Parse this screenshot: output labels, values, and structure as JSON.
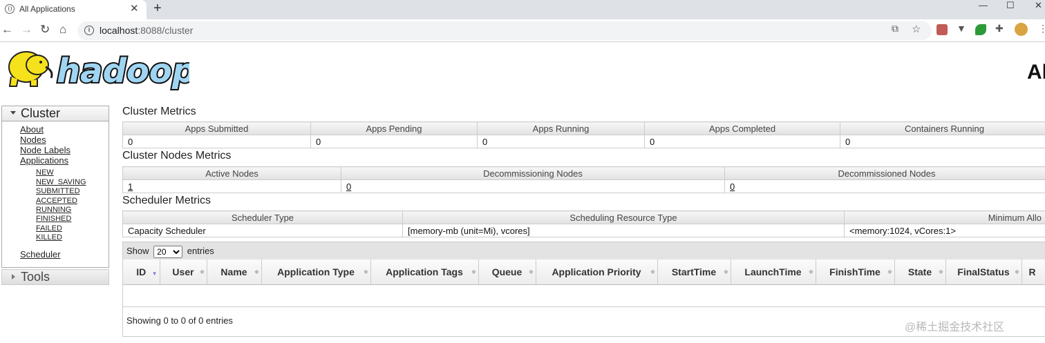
{
  "browser": {
    "tab_title": "All Applications",
    "tab_close": "✕",
    "new_tab": "+",
    "url_host": "localhost",
    "url_path": ":8088/cluster",
    "win_min": "—",
    "win_max": "☐",
    "win_close": "✕"
  },
  "header": {
    "title": "Al"
  },
  "sidebar": {
    "cluster_label": "Cluster",
    "links": [
      "About",
      "Nodes",
      "Node Labels",
      "Applications"
    ],
    "app_states": [
      "NEW",
      "NEW_SAVING",
      "SUBMITTED",
      "ACCEPTED",
      "RUNNING",
      "FINISHED",
      "FAILED",
      "KILLED"
    ],
    "scheduler": "Scheduler",
    "tools_label": "Tools"
  },
  "cluster_metrics": {
    "title": "Cluster Metrics",
    "headers": [
      "Apps Submitted",
      "Apps Pending",
      "Apps Running",
      "Apps Completed",
      "Containers Running"
    ],
    "values": [
      "0",
      "0",
      "0",
      "0",
      "0"
    ]
  },
  "nodes_metrics": {
    "title": "Cluster Nodes Metrics",
    "headers": [
      "Active Nodes",
      "Decommissioning Nodes",
      "Decommissioned Nodes"
    ],
    "values": [
      "1",
      "0",
      "0"
    ]
  },
  "scheduler_metrics": {
    "title": "Scheduler Metrics",
    "headers": [
      "Scheduler Type",
      "Scheduling Resource Type",
      "Minimum Allo"
    ],
    "values": [
      "Capacity Scheduler",
      "[memory-mb (unit=Mi), vcores]",
      "<memory:1024, vCores:1>"
    ]
  },
  "apps_table": {
    "show_label": "Show",
    "entries_value": "20",
    "entries_label": "entries",
    "columns": [
      "ID",
      "User",
      "Name",
      "Application Type",
      "Application Tags",
      "Queue",
      "Application Priority",
      "StartTime",
      "LaunchTime",
      "FinishTime",
      "State",
      "FinalStatus",
      "R"
    ],
    "info": "Showing 0 to 0 of 0 entries"
  },
  "watermark": "@稀土掘金技术社区"
}
